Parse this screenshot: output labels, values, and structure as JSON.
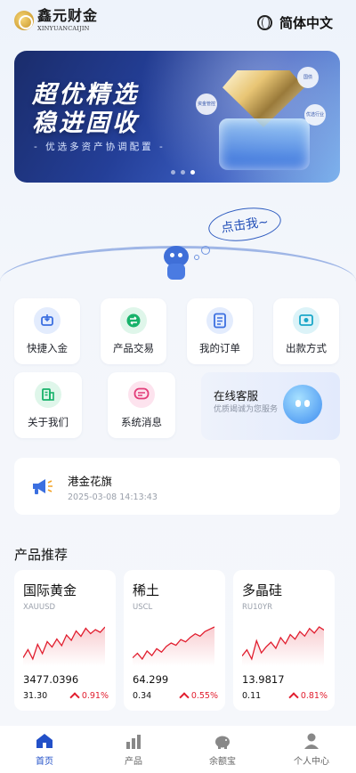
{
  "header": {
    "logo_cn": "鑫元财金",
    "logo_en": "XINYUANCAIJIN",
    "language": "简体中文"
  },
  "banner": {
    "title_line1": "超优精选",
    "title_line2": "稳进固收",
    "subtitle": "- 优选多资产协调配置 -",
    "bubbles": [
      "资金管控",
      "国债",
      "优选行业"
    ],
    "slides": 3,
    "active_slide": 3
  },
  "mascot": {
    "bubble_text": "点击我~"
  },
  "menu": [
    {
      "label": "快捷入金",
      "icon": "deposit-icon",
      "color": "#3b6fe0",
      "bg": "#e3ecfd"
    },
    {
      "label": "产品交易",
      "icon": "exchange-icon",
      "color": "#17b26a",
      "bg": "#dff6ea"
    },
    {
      "label": "我的订单",
      "icon": "order-icon",
      "color": "#3b6fe0",
      "bg": "#e3ecfd"
    },
    {
      "label": "出款方式",
      "icon": "withdraw-icon",
      "color": "#1aa6c8",
      "bg": "#dcf3f8"
    },
    {
      "label": "关于我们",
      "icon": "about-icon",
      "color": "#17b26a",
      "bg": "#dff6ea"
    },
    {
      "label": "系统消息",
      "icon": "message-icon",
      "color": "#e23b78",
      "bg": "#fde3ee"
    }
  ],
  "service": {
    "title": "在线客服",
    "subtitle": "优质竭诚为您服务"
  },
  "news": {
    "title": "港金花旗",
    "time": "2025-03-08 14:13:43"
  },
  "section": {
    "title": "产品推荐"
  },
  "products": [
    {
      "name": "国际黄金",
      "code": "XAUUSD",
      "price": "3477.0396",
      "change": "31.30",
      "pct": "0.91%",
      "spark": [
        30,
        36,
        29,
        40,
        33,
        42,
        38,
        44,
        39,
        47,
        43,
        50,
        46,
        52,
        48,
        51,
        49,
        53
      ]
    },
    {
      "name": "稀土",
      "code": "USCL",
      "price": "64.299",
      "change": "0.34",
      "pct": "0.55%",
      "spark": [
        20,
        24,
        19,
        26,
        22,
        28,
        25,
        30,
        33,
        31,
        36,
        34,
        38,
        41,
        39,
        43,
        45,
        47
      ]
    },
    {
      "name": "多晶硅",
      "code": "RU10YR",
      "price": "13.9817",
      "change": "0.11",
      "pct": "0.81%",
      "spark": [
        28,
        32,
        26,
        38,
        30,
        34,
        37,
        33,
        40,
        36,
        42,
        39,
        44,
        41,
        46,
        43,
        47,
        45
      ]
    }
  ],
  "colors": {
    "accent": "#2250c8",
    "up": "#e11d2e"
  },
  "tabs": [
    {
      "label": "首页",
      "icon": "home-icon",
      "active": true
    },
    {
      "label": "产品",
      "icon": "chart-bars-icon",
      "active": false
    },
    {
      "label": "余额宝",
      "icon": "piggy-bank-icon",
      "active": false
    },
    {
      "label": "个人中心",
      "icon": "user-icon",
      "active": false
    }
  ]
}
